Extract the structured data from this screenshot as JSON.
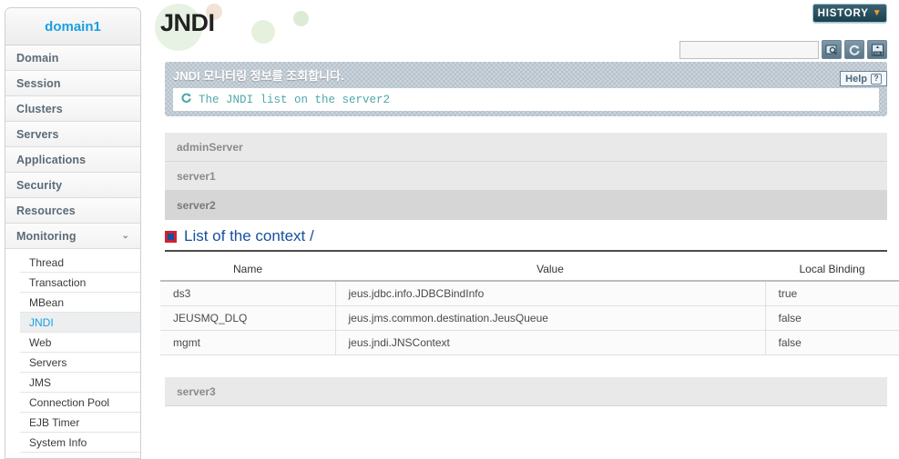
{
  "sidebar": {
    "domain_label": "domain1",
    "items": [
      {
        "label": "Domain",
        "expandable": false
      },
      {
        "label": "Session",
        "expandable": false
      },
      {
        "label": "Clusters",
        "expandable": false
      },
      {
        "label": "Servers",
        "expandable": false
      },
      {
        "label": "Applications",
        "expandable": false
      },
      {
        "label": "Security",
        "expandable": false
      },
      {
        "label": "Resources",
        "expandable": false
      },
      {
        "label": "Monitoring",
        "expandable": true,
        "chevron": "⌄"
      }
    ],
    "sub_items": [
      {
        "label": "Thread",
        "active": false
      },
      {
        "label": "Transaction",
        "active": false
      },
      {
        "label": "MBean",
        "active": false
      },
      {
        "label": "JNDI",
        "active": true
      },
      {
        "label": "Web",
        "active": false
      },
      {
        "label": "Servers",
        "active": false
      },
      {
        "label": "JMS",
        "active": false
      },
      {
        "label": "Connection Pool",
        "active": false
      },
      {
        "label": "EJB Timer",
        "active": false
      },
      {
        "label": "System Info",
        "active": false
      }
    ]
  },
  "header": {
    "page_title": "JNDI",
    "history_label": "HISTORY",
    "history_chevron": "▼",
    "help_label": "Help",
    "help_mark": "?"
  },
  "search": {
    "value": "",
    "placeholder": "",
    "buttons": [
      {
        "name": "search-icon",
        "glyph": "⌕"
      },
      {
        "name": "refresh-icon",
        "glyph": "↻"
      },
      {
        "name": "xml-export-icon",
        "glyph": "XML"
      }
    ]
  },
  "banner": {
    "title": "JNDI 모니터링 정보를 조회합니다.",
    "sub_icon": "refresh-icon",
    "sub_text": "The JNDI list on the server2"
  },
  "servers": [
    {
      "label": "adminServer",
      "selected": false
    },
    {
      "label": "server1",
      "selected": false
    },
    {
      "label": "server2",
      "selected": true
    },
    {
      "label": "server3",
      "selected": false
    }
  ],
  "context": {
    "icon": "red-blue-square-icon",
    "title": "List of the context /",
    "columns": [
      "Name",
      "Value",
      "Local Binding"
    ],
    "rows": [
      {
        "name": "ds3",
        "value": "jeus.jdbc.info.JDBCBindInfo",
        "local_binding": "true"
      },
      {
        "name": "JEUSMQ_DLQ",
        "value": "jeus.jms.common.destination.JeusQueue",
        "local_binding": "false"
      },
      {
        "name": "mgmt",
        "value": "jeus.jndi.JNSContext",
        "local_binding": "false"
      }
    ]
  },
  "colors": {
    "accent_blue": "#1a9fe0",
    "title_blue": "#16509e",
    "history_teal": "#27505f",
    "history_chevron_orange": "#f3a02a",
    "banner_gray": "#b6c2cc",
    "sub_text_teal": "#4fa8a8",
    "selected_row": "#d6d6d6"
  }
}
